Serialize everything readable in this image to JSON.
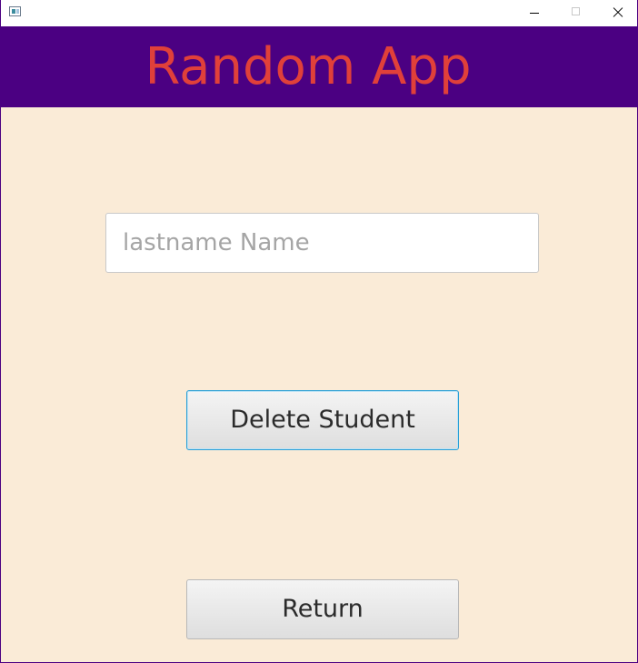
{
  "window": {
    "title": "",
    "icons": {
      "app": "app-window-icon",
      "minimize": "minimize-icon",
      "maximize": "maximize-icon",
      "close": "close-icon"
    }
  },
  "header": {
    "title": "Random App"
  },
  "form": {
    "name_input": {
      "value": "",
      "placeholder": "lastname Name"
    },
    "delete_label": "Delete Student",
    "return_label": "Return"
  },
  "colors": {
    "header_bg": "#4b0082",
    "title_text": "#e0403a",
    "content_bg": "#faebd7",
    "focus_border": "#2a9fd6"
  }
}
